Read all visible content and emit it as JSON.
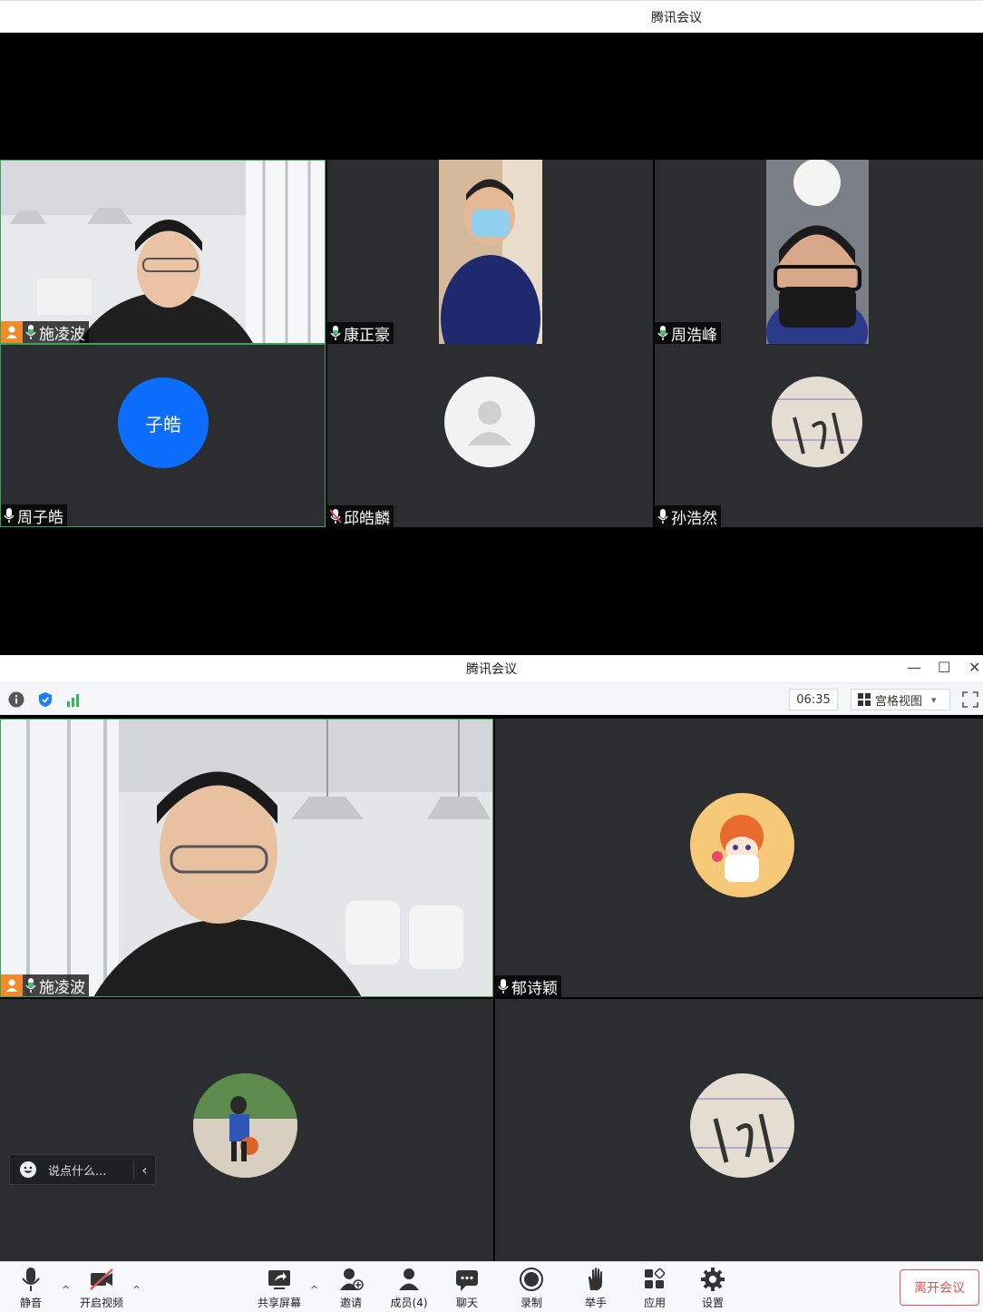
{
  "window1": {
    "title": "腾讯会议",
    "participants": [
      {
        "name": "施凌波",
        "host": true,
        "mic": "on"
      },
      {
        "name": "康正豪",
        "host": false,
        "mic": "on"
      },
      {
        "name": "周浩峰",
        "host": false,
        "mic": "on"
      },
      {
        "name": "周子皓",
        "host": false,
        "mic": "on",
        "avatar_text": "子皓",
        "avatar_color": "#0d6efd"
      },
      {
        "name": "邱皓麟",
        "host": false,
        "mic": "muted"
      },
      {
        "name": "孙浩然",
        "host": false,
        "mic": "on"
      }
    ]
  },
  "window2": {
    "title": "腾讯会议",
    "window_controls": {
      "minimize": "—",
      "maximize": "☐",
      "close": "✕"
    },
    "toolbar": {
      "timer": "06:35",
      "view_label": "宫格视图",
      "view_caret": "▾"
    },
    "participants": [
      {
        "name": "施凌波",
        "host": true,
        "mic": "on"
      },
      {
        "name": "郁诗颖",
        "host": false,
        "mic": "on"
      }
    ],
    "chat_input": {
      "placeholder": "说点什么...",
      "collapse": "‹"
    },
    "bottom_bar": {
      "mute": "静音",
      "video": "开启视频",
      "share": "共享屏幕",
      "invite": "邀请",
      "members": "成员(4)",
      "chat": "聊天",
      "record": "录制",
      "raise_hand": "举手",
      "apps": "应用",
      "settings": "设置",
      "leave": "离开会议"
    },
    "colors": {
      "accent": "#1e7cf2",
      "leave": "#e05555",
      "host_badge": "#f08a2c",
      "active_border": "#3aa25a"
    }
  }
}
